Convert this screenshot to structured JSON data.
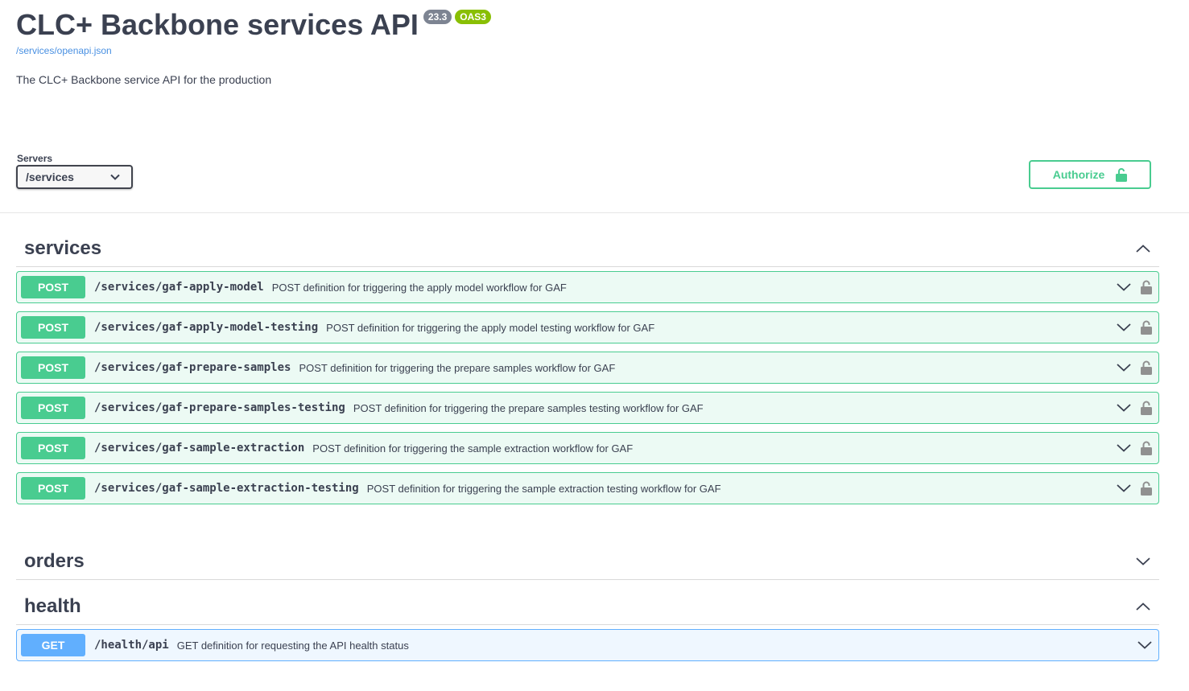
{
  "info": {
    "title": "CLC+ Backbone services API",
    "version": "23.3",
    "oas_badge": "OAS3",
    "spec_link": "/services/openapi.json",
    "description": "The CLC+ Backbone service API for the production"
  },
  "servers": {
    "label": "Servers",
    "selected": "/services"
  },
  "authorize": {
    "label": "Authorize"
  },
  "tags": [
    {
      "name": "services",
      "expanded": true,
      "operations": [
        {
          "method": "POST",
          "path": "/services/gaf-apply-model",
          "summary": "POST definition for triggering the apply model workflow for GAF"
        },
        {
          "method": "POST",
          "path": "/services/gaf-apply-model-testing",
          "summary": "POST definition for triggering the apply model testing workflow for GAF"
        },
        {
          "method": "POST",
          "path": "/services/gaf-prepare-samples",
          "summary": "POST definition for triggering the prepare samples workflow for GAF"
        },
        {
          "method": "POST",
          "path": "/services/gaf-prepare-samples-testing",
          "summary": "POST definition for triggering the prepare samples testing workflow for GAF"
        },
        {
          "method": "POST",
          "path": "/services/gaf-sample-extraction",
          "summary": "POST definition for triggering the sample extraction workflow for GAF"
        },
        {
          "method": "POST",
          "path": "/services/gaf-sample-extraction-testing",
          "summary": "POST definition for triggering the sample extraction testing workflow for GAF"
        }
      ]
    },
    {
      "name": "orders",
      "expanded": false,
      "operations": []
    },
    {
      "name": "health",
      "expanded": true,
      "operations": [
        {
          "method": "GET",
          "path": "/health/api",
          "summary": "GET definition for requesting the API health status"
        }
      ]
    }
  ],
  "colors": {
    "post": "#49cc90",
    "get": "#61affe",
    "text": "#3b4151",
    "link": "#4990e2",
    "version_badge": "#7d8492",
    "oas_badge": "#89bf04"
  }
}
